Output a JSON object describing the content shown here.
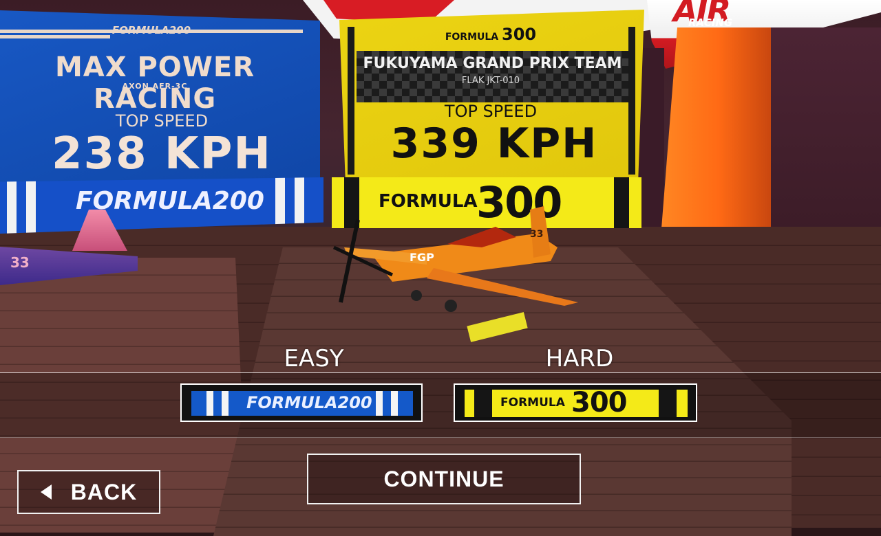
{
  "scene": {
    "air_logo_text": "AIR",
    "racing_logo_text": "RACING"
  },
  "boards": {
    "left": {
      "brand": "FORMULA200",
      "team": "MAX POWER RACING",
      "plane": "AXON AFR-3C",
      "top_speed_label": "TOP SPEED",
      "top_speed_value": "238 KPH",
      "strip_text": "FORMULA200",
      "color": "#1452c2"
    },
    "right": {
      "brand_word": "FORMULA",
      "brand_num": "300",
      "team": "FUKUYAMA GRAND PRIX TEAM",
      "plane": "FLAK JKT-010",
      "top_speed_label": "TOP SPEED",
      "top_speed_value": "339 KPH",
      "strip_word": "FORMULA",
      "strip_num": "300",
      "color": "#f4ea18"
    }
  },
  "planes": {
    "left_number": "33",
    "center_logo": "FGP",
    "center_number": "33"
  },
  "difficulty": {
    "easy": {
      "label": "EASY",
      "badge_text": "FORMULA200"
    },
    "hard": {
      "label": "HARD",
      "badge_word": "FORMULA",
      "badge_num": "300"
    }
  },
  "buttons": {
    "back": "BACK",
    "continue": "CONTINUE"
  }
}
